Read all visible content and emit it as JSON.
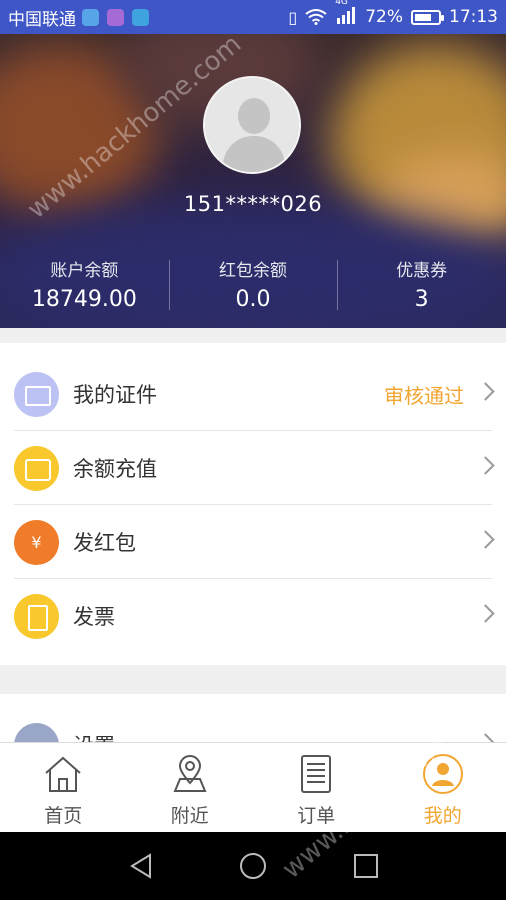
{
  "status_bar": {
    "carrier": "中国联通",
    "network": "4G",
    "battery": "72%",
    "battery_level": 0.72,
    "time": "17:13"
  },
  "profile": {
    "phone": "151*****026"
  },
  "stats": [
    {
      "label": "账户余额",
      "value": "18749.00"
    },
    {
      "label": "红包余额",
      "value": "0.0"
    },
    {
      "label": "优惠券",
      "value": "3"
    }
  ],
  "menu": [
    {
      "label": "我的证件",
      "status": "审核通过",
      "icon": "id-card-icon"
    },
    {
      "label": "余额充值",
      "icon": "wallet-icon"
    },
    {
      "label": "发红包",
      "icon": "red-packet-icon",
      "glyph": "¥"
    },
    {
      "label": "发票",
      "icon": "invoice-icon"
    }
  ],
  "settings": {
    "label": "设置",
    "icon": "settings-icon"
  },
  "tabs": [
    {
      "label": "首页",
      "icon": "home-icon"
    },
    {
      "label": "附近",
      "icon": "location-icon"
    },
    {
      "label": "订单",
      "icon": "order-list-icon"
    },
    {
      "label": "我的",
      "icon": "profile-icon",
      "active": true
    }
  ],
  "watermark": "www.hackhome.com",
  "colors": {
    "status_bar": "#3f56c7",
    "accent": "#f2a632",
    "yellow_icon": "#f8c82d",
    "orange_icon": "#f07c2a",
    "id_icon": "#bcc2f3"
  }
}
